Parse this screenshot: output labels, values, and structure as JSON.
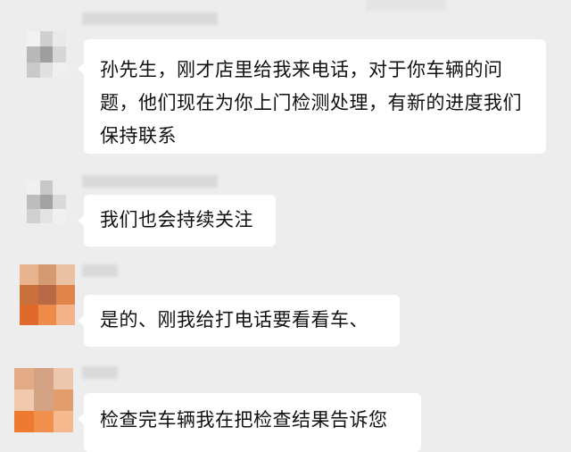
{
  "messages": [
    {
      "sender": "friend",
      "text": "孙先生，刚才店里给我来电话，对于你车辆的问题，他们现在为你上门检测处理，有新的进度我们保持联系",
      "avatar": "pixelated-gray-avatar"
    },
    {
      "sender": "friend",
      "text": "我们也会持续关注",
      "avatar": "pixelated-gray-avatar"
    },
    {
      "sender": "user",
      "text": "是的、刚我给打电话要看看车、",
      "avatar": "pixelated-orange-avatar"
    },
    {
      "sender": "user",
      "text": "检查完车辆我在把检查结果告诉您",
      "avatar": "pixelated-orange-avatar"
    }
  ],
  "colors": {
    "background": "#ededed",
    "bubble": "#ffffff",
    "text": "#111111"
  }
}
